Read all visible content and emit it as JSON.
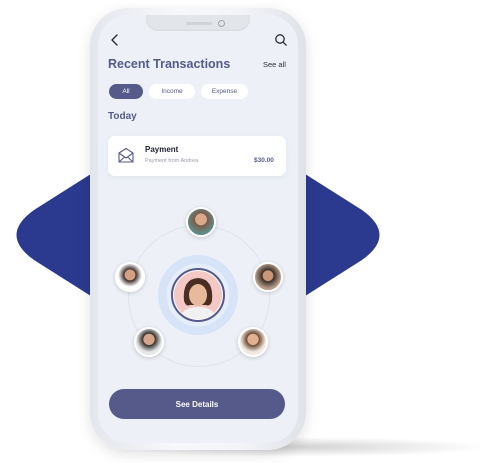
{
  "header": {
    "title": "Recent Transactions",
    "see_all": "See all",
    "back_icon": "back-chevron-icon",
    "search_icon": "search-icon"
  },
  "tabs": [
    {
      "label": "All",
      "selected": true
    },
    {
      "label": "Income",
      "selected": false
    },
    {
      "label": "Expense",
      "selected": false
    }
  ],
  "section": {
    "label": "Today"
  },
  "transaction": {
    "title": "Payment",
    "subtitle": "Payment from Andrea",
    "amount": "$30.00",
    "icon": "envelope-icon"
  },
  "contacts": [
    "contact-avatar",
    "contact-avatar",
    "contact-avatar",
    "contact-avatar",
    "contact-avatar",
    "contact-avatar"
  ],
  "action": {
    "label": "See Details"
  },
  "colors": {
    "accent": "#555a8a",
    "screen_bg": "#edf1f7",
    "backdrop_shape": "#2b3a8f"
  }
}
